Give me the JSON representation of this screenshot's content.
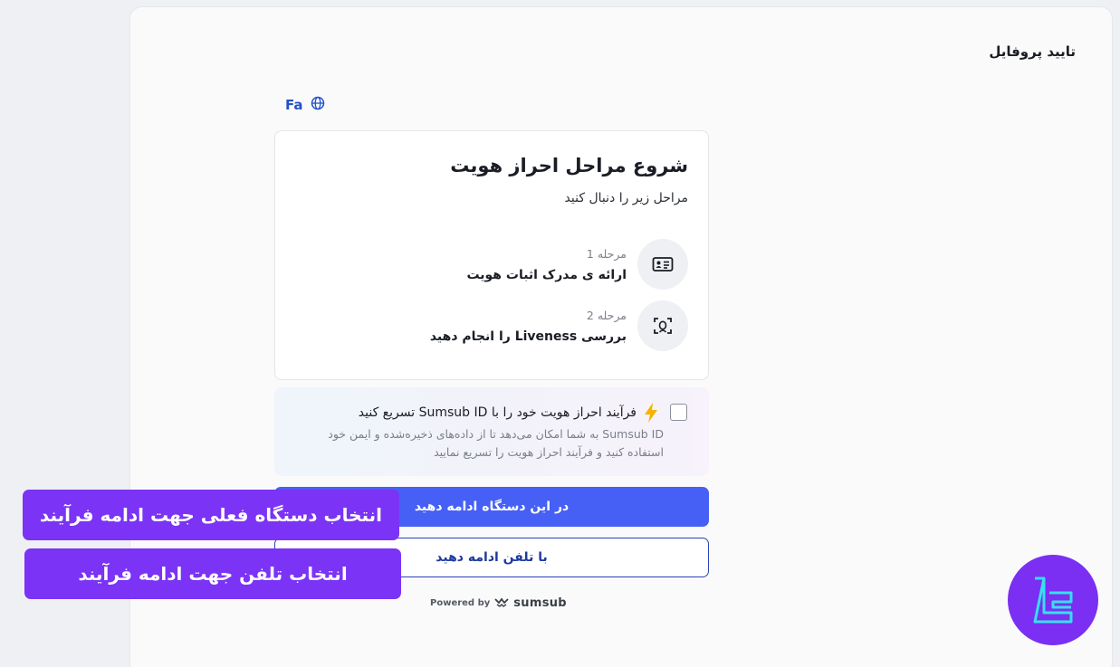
{
  "page": {
    "title": "تایید پروفایل",
    "language_label": "Fa"
  },
  "steps_card": {
    "title": "شروع مراحل احراز هویت",
    "subtitle": "مراحل زیر را دنبال کنید",
    "steps": [
      {
        "number": "مرحله 1",
        "label": "ارائه ی مدرک اثبات هویت",
        "icon": "id-card-icon"
      },
      {
        "number": "مرحله 2",
        "label": "بررسی Liveness را انجام دهید",
        "icon": "face-scan-icon"
      }
    ]
  },
  "sumsub_option": {
    "title": "فرآیند احراز هویت خود را با Sumsub ID تسریع کنید",
    "description": "Sumsub ID به شما امکان می‌دهد تا از داده‌های ذخیره‌شده و ایمن خود استفاده کنید و فرآیند احراز هویت را تسریع نمایید",
    "checked": false
  },
  "buttons": {
    "continue_here": "در این دستگاه ادامه دهید",
    "continue_phone": "با تلفن ادامه دهید"
  },
  "footer": {
    "powered_by": "Powered by",
    "brand": "sumsub"
  },
  "callouts": {
    "current_device": "انتخاب دستگاه فعلی جهت ادامه فرآیند",
    "phone": "انتخاب تلفن جهت ادامه فرآیند"
  },
  "colors": {
    "primary": "#4660f5",
    "callout": "#7b33f5",
    "logo_bg": "#7a2ff2",
    "logo_accent": "#36e0f0"
  }
}
